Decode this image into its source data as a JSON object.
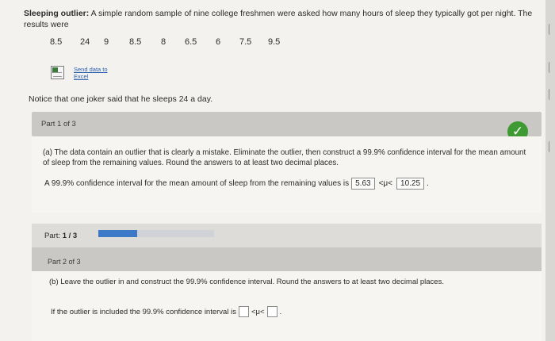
{
  "problem": {
    "title": "Sleeping outlier:",
    "text": "A simple random sample of nine college freshmen were asked how many hours of sleep they typically got per night. The results were",
    "values": [
      "8.5",
      "24",
      "9",
      "8.5",
      "8",
      "6.5",
      "6",
      "7.5",
      "9.5"
    ],
    "excel_link": "Send data to Excel",
    "notice": "Notice that one joker said that he sleeps 24 a day."
  },
  "part1": {
    "label": "Part 1 of 3",
    "question": "(a) The data contain an outlier that is clearly a mistake. Eliminate the outlier, then construct a 99.9% confidence interval for the mean amount of sleep from the remaining values. Round the answers to at least two decimal places.",
    "answer_prefix": "A 99.9% confidence interval for the mean amount of sleep from the remaining values is",
    "lower": "5.63",
    "upper": "10.25",
    "symbol": "<μ<",
    "period": "."
  },
  "progress": {
    "label": "Part:",
    "value": "1 / 3",
    "fraction": 0.333
  },
  "part2": {
    "label": "Part 2 of 3",
    "question": "(b) Leave the outlier in and construct the 99.9% confidence interval. Round the answers to at least two decimal places.",
    "answer_prefix": "If the outlier is included the 99.9% confidence interval is",
    "symbol": "<μ<",
    "period": "."
  },
  "icons": {
    "check": "✓",
    "excel": "excel-icon"
  },
  "colors": {
    "check_green": "#3f9a34",
    "progress_blue": "#3d79c7",
    "link_blue": "#2a5fb0"
  }
}
